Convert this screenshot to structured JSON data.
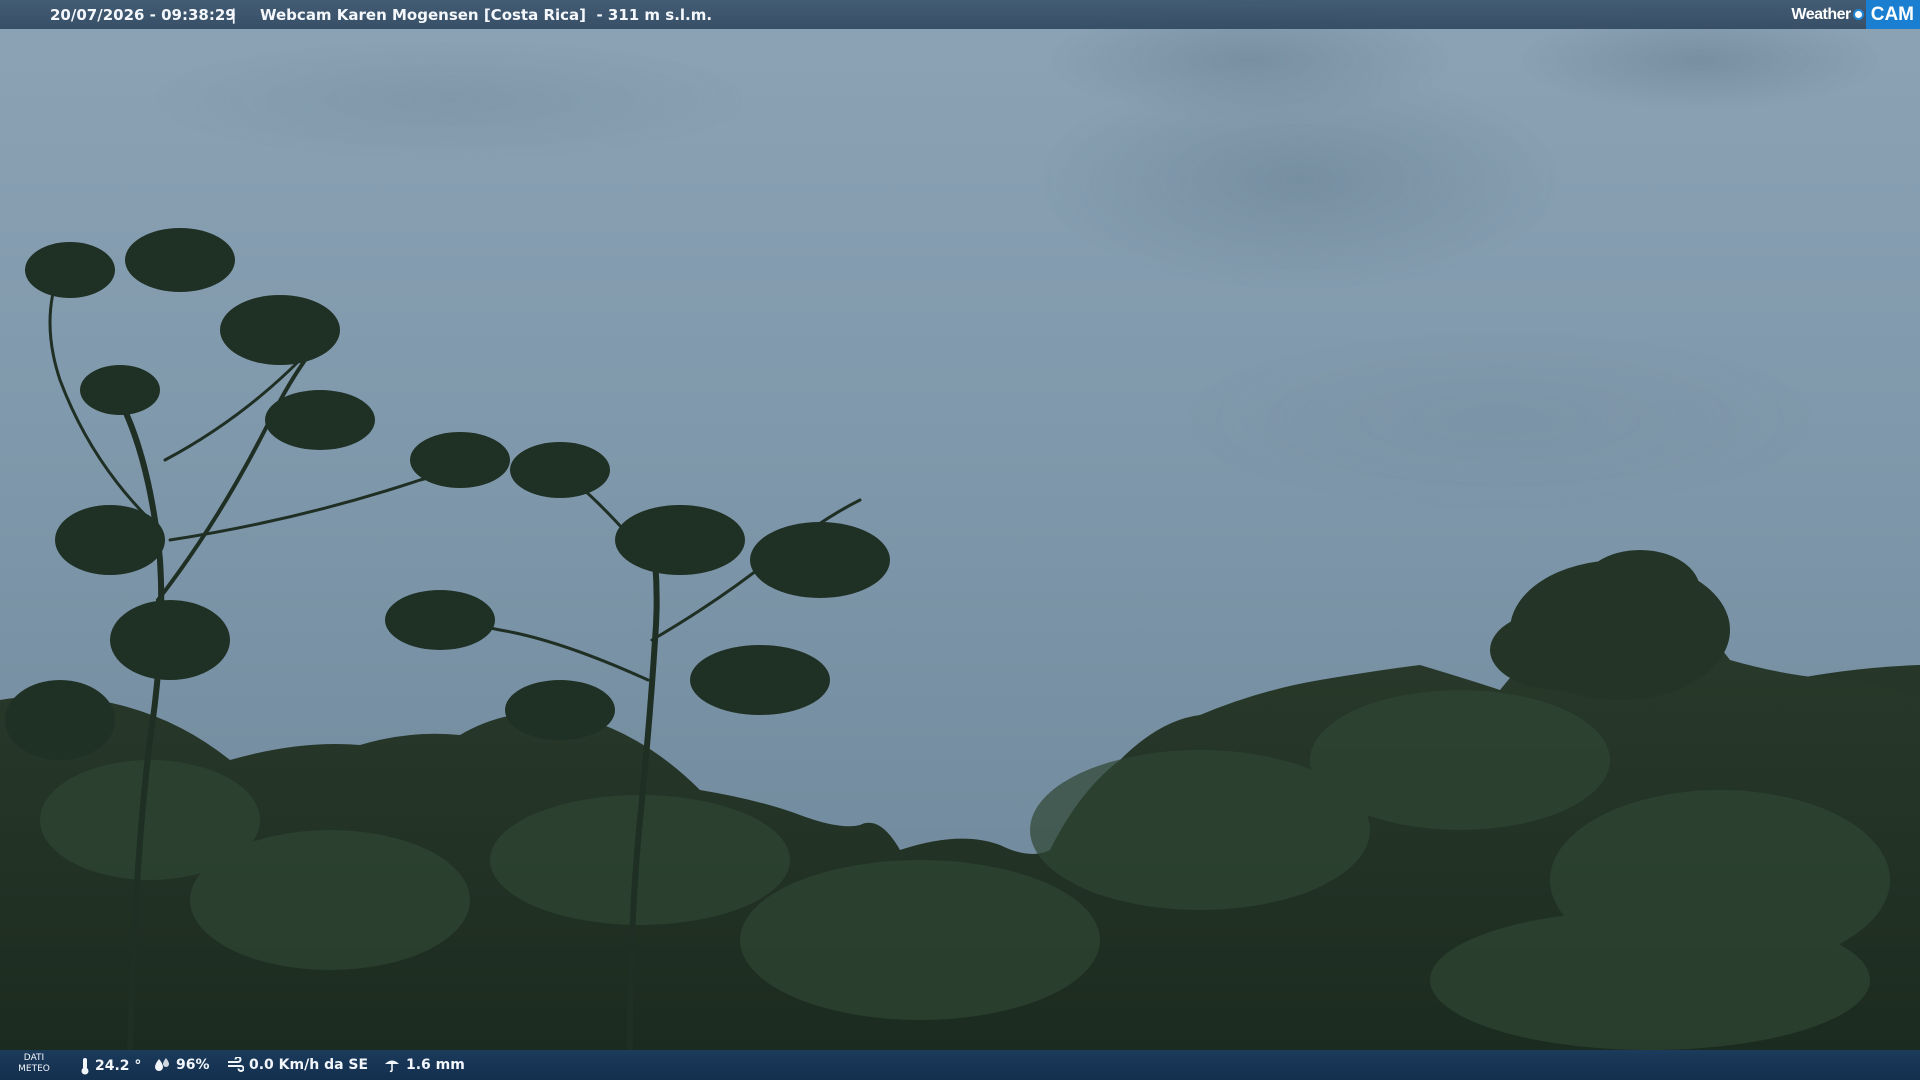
{
  "header": {
    "timestamp": "20/07/2026 - 09:38:29",
    "separator": "|",
    "camera_title": "Webcam Karen Mogensen [Costa Rica]  - 311 m s.l.m."
  },
  "logo": {
    "weather_text": "Weather",
    "cam_text": "CAM"
  },
  "weather_data": {
    "label": "DATI METEO",
    "temperature": "24.2 °",
    "humidity": "96%",
    "wind": "0.0 Km/h da SE",
    "rain": "1.6 mm"
  },
  "scene": {
    "sky_colors": [
      "#8ea5b7",
      "#7f97aa",
      "#6e879b"
    ],
    "foliage_colors": [
      "#1e2e22",
      "#27392a",
      "#2f4633"
    ]
  }
}
